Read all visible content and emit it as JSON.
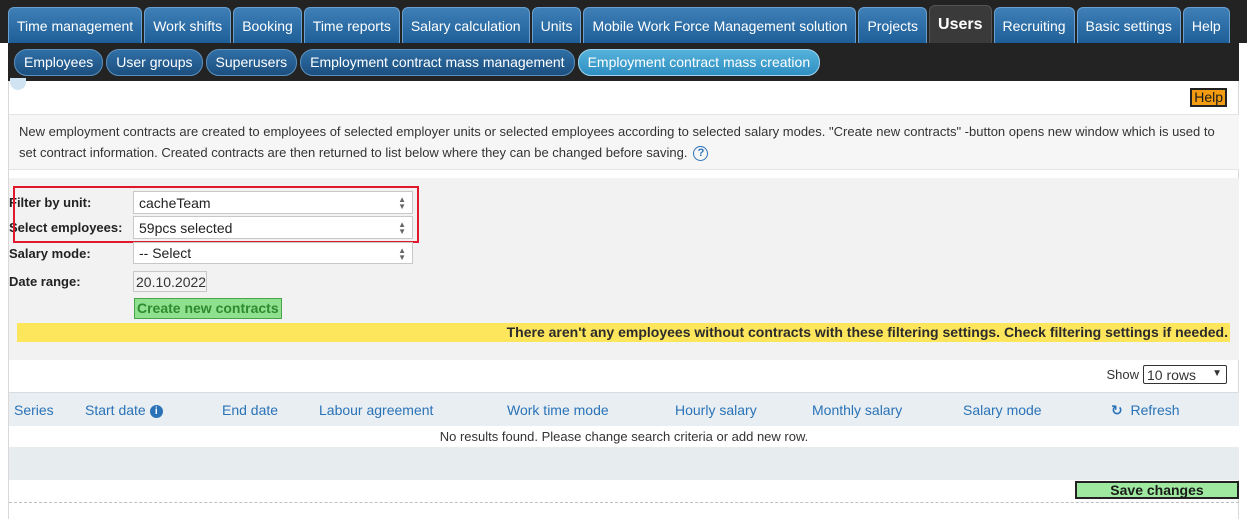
{
  "topnav": {
    "tabs": [
      {
        "label": "Time management"
      },
      {
        "label": "Work shifts"
      },
      {
        "label": "Booking"
      },
      {
        "label": "Time reports"
      },
      {
        "label": "Salary calculation"
      },
      {
        "label": "Units"
      },
      {
        "label": "Mobile Work Force Management solution"
      },
      {
        "label": "Projects"
      },
      {
        "label": "Users"
      },
      {
        "label": "Recruiting"
      },
      {
        "label": "Basic settings"
      },
      {
        "label": "Help"
      }
    ],
    "active": "Users"
  },
  "subnav": {
    "items": [
      {
        "label": "Employees"
      },
      {
        "label": "User groups"
      },
      {
        "label": "Superusers"
      },
      {
        "label": "Employment contract mass management"
      },
      {
        "label": "Employment contract mass creation"
      }
    ],
    "active": "Employment contract mass creation"
  },
  "help_button": "Help",
  "intro_text": "New employment contracts are created to employees of selected employer units or selected employees according to selected salary modes. \"Create new contracts\" -button opens new window which is used to set contract information. Created contracts are then returned to list below where they can be changed before saving.",
  "filters": {
    "unit_label": "Filter by unit:",
    "unit_value": "cacheTeam",
    "employees_label": "Select employees:",
    "employees_value": "59pcs selected",
    "salary_mode_label": "Salary mode:",
    "salary_mode_value": "-- Select",
    "date_range_label": "Date range:",
    "date_value": "20.10.2022",
    "create_button": "Create new contracts"
  },
  "warning": "There aren't any employees without contracts with these filtering settings. Check filtering settings if needed.",
  "table": {
    "show_label": "Show",
    "rows_option": "10 rows",
    "columns": [
      "Series",
      "Start date",
      "End date",
      "Labour agreement",
      "Work time mode",
      "Hourly salary",
      "Monthly salary",
      "Salary mode"
    ],
    "refresh_label": "Refresh",
    "no_results": "No results found. Please change search criteria or add new row."
  },
  "save_button": "Save changes",
  "colors": {
    "nav_bg": "#232323",
    "tab_blue": "#2a6aa6",
    "warning_yellow": "#fde55c",
    "save_green": "#9fe89f",
    "highlight_red": "#e0182b"
  }
}
